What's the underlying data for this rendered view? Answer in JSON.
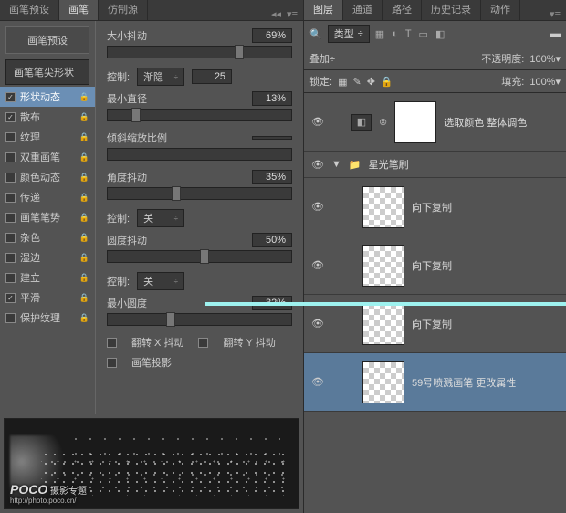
{
  "brushPanel": {
    "tabs": {
      "preset": "画笔预设",
      "brush": "画笔",
      "clone": "仿制源"
    },
    "presetBtn": "画笔预设",
    "tipShape": "画笔笔尖形状",
    "items": [
      {
        "label": "形状动态",
        "checked": true,
        "selected": true
      },
      {
        "label": "散布",
        "checked": true
      },
      {
        "label": "纹理",
        "checked": false
      },
      {
        "label": "双重画笔",
        "checked": false
      },
      {
        "label": "颜色动态",
        "checked": false
      },
      {
        "label": "传递",
        "checked": false
      },
      {
        "label": "画笔笔势",
        "checked": false
      },
      {
        "label": "杂色",
        "checked": false
      },
      {
        "label": "湿边",
        "checked": false
      },
      {
        "label": "建立",
        "checked": false
      },
      {
        "label": "平滑",
        "checked": true
      },
      {
        "label": "保护纹理",
        "checked": false
      }
    ],
    "ctrlLabel": "控制:",
    "sizeJitter": {
      "label": "大小抖动",
      "value": "69%"
    },
    "sizeCtrl": {
      "option": "渐隐",
      "steps": "25"
    },
    "minDiam": {
      "label": "最小直径",
      "value": "13%"
    },
    "tiltScale": "倾斜缩放比例",
    "angJitter": {
      "label": "角度抖动",
      "value": "35%"
    },
    "angCtrl": {
      "option": "关"
    },
    "rndJitter": {
      "label": "圆度抖动",
      "value": "50%"
    },
    "rndCtrl": {
      "option": "关"
    },
    "minRnd": {
      "label": "最小圆度",
      "value": "32%"
    },
    "flipX": "翻转 X 抖动",
    "flipY": "翻转 Y 抖动",
    "proj": "画笔投影"
  },
  "watermark": {
    "brand": "POCO",
    "sub": "摄影专题",
    "url": "http://photo.poco.cn/"
  },
  "layersPanel": {
    "tabs": {
      "layers": "图层",
      "channels": "通道",
      "paths": "路径",
      "history": "历史记录",
      "actions": "动作"
    },
    "kind": "类型",
    "blend": "叠加",
    "opacityLbl": "不透明度:",
    "opacity": "100%",
    "lockLbl": "锁定:",
    "fillLbl": "填充:",
    "fill": "100%",
    "layers": [
      {
        "name": "选取颜色 整体调色",
        "type": "adj"
      },
      {
        "name": "星光笔刷",
        "type": "group"
      },
      {
        "name": "向下复制",
        "type": "bmp"
      },
      {
        "name": "向下复制",
        "type": "bmp"
      },
      {
        "name": "向下复制",
        "type": "bmp"
      },
      {
        "name": "59号喷溅画笔 更改属性",
        "type": "bmp",
        "selected": true
      }
    ]
  }
}
